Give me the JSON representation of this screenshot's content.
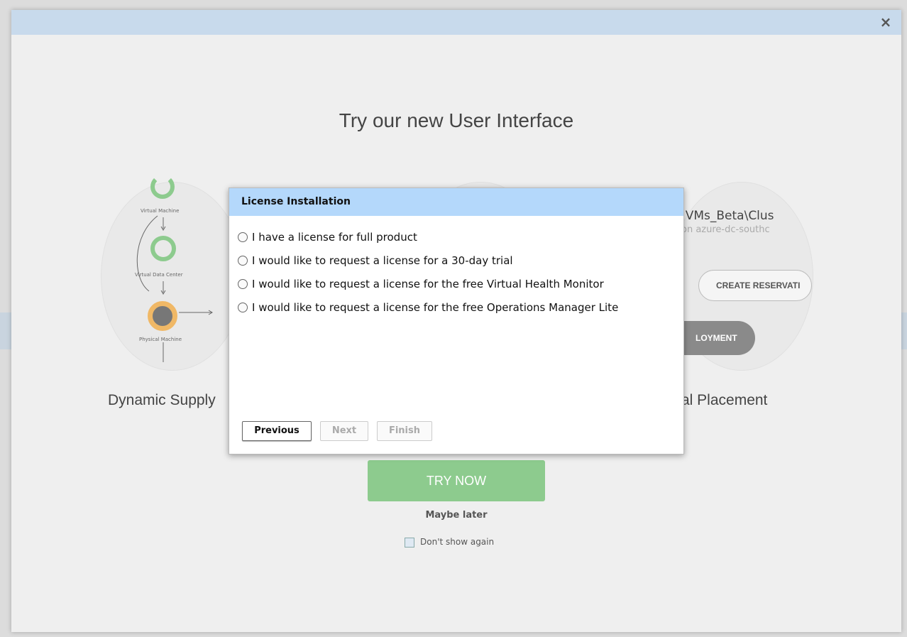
{
  "outer_dialog": {
    "close_label": "×",
    "title": "Try our new User Interface",
    "features": {
      "left_caption": "Dynamic Supply",
      "right_caption": "al Placement",
      "diagram": {
        "virtual_machine": "Virtual Machine",
        "virtual_data_center": "Virtual Data Center",
        "physical_machine": "Physical Machine"
      },
      "right_card_title": ":VMs_Beta\\Clus",
      "right_card_subtitle": "on azure-dc-southc",
      "create_button": "CREATE RESERVATI",
      "deploy_button": "LOYMENT"
    },
    "try_now": "TRY NOW",
    "maybe_later": "Maybe later",
    "dont_show_again": "Don't show again"
  },
  "license_dialog": {
    "title": "License Installation",
    "options": [
      "I have a license for full product",
      "I would like to request a license for a 30-day trial",
      "I would like to request a license for the free Virtual Health Monitor",
      "I would like to request a license for the free Operations Manager Lite"
    ],
    "buttons": {
      "previous": "Previous",
      "next": "Next",
      "finish": "Finish"
    }
  },
  "colors": {
    "header_blue": "#b4d8fb",
    "try_now_green": "#8dcb8e",
    "ring_green": "#8dcb8e",
    "ring_orange": "#f0b866"
  }
}
